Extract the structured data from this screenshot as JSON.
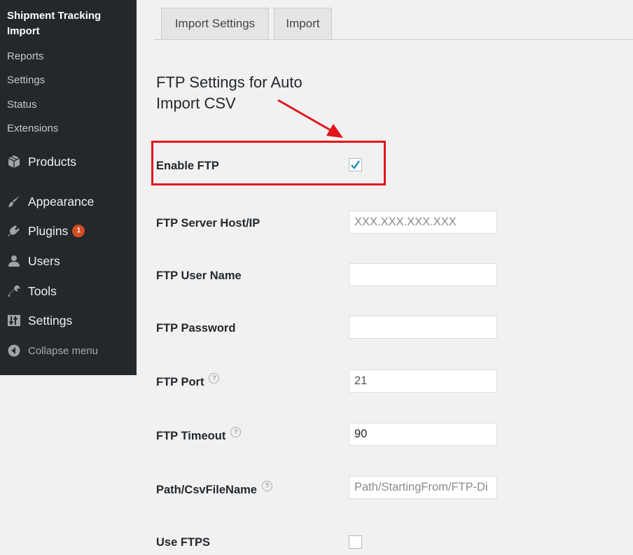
{
  "sidebar": {
    "submenu_title": "Shipment Tracking Import",
    "submenu": [
      "Reports",
      "Settings",
      "Status",
      "Extensions"
    ],
    "menu": [
      {
        "label": "Products",
        "icon": "products-cube-icon"
      },
      {
        "label": "Appearance",
        "icon": "paintbrush-icon"
      },
      {
        "label": "Plugins",
        "icon": "plugin-plug-icon",
        "badge": "1"
      },
      {
        "label": "Users",
        "icon": "users-icon"
      },
      {
        "label": "Tools",
        "icon": "wrench-icon"
      },
      {
        "label": "Settings",
        "icon": "settings-sliders-icon"
      }
    ],
    "collapse": "Collapse menu"
  },
  "tabs": [
    "Import Settings",
    "Import"
  ],
  "heading": "FTP Settings for Auto Import CSV",
  "form": {
    "enable_ftp": {
      "label": "Enable FTP",
      "checked": true
    },
    "host": {
      "label": "FTP Server Host/IP",
      "value": "",
      "placeholder": "XXX.XXX.XXX.XXX"
    },
    "user": {
      "label": "FTP User Name",
      "value": ""
    },
    "password": {
      "label": "FTP Password",
      "value": ""
    },
    "port": {
      "label": "FTP Port",
      "value": "21"
    },
    "timeout": {
      "label": "FTP Timeout",
      "value": "90"
    },
    "path": {
      "label": "Path/CsvFileName",
      "value": "",
      "placeholder": "Path/StartingFrom/FTP-Di"
    },
    "ftps": {
      "label": "Use FTPS",
      "checked": false
    }
  },
  "colors": {
    "sidebar_bg": "#23282d",
    "highlight": "#e2151b",
    "badge": "#d54e21",
    "check": "#1e8cbe"
  }
}
